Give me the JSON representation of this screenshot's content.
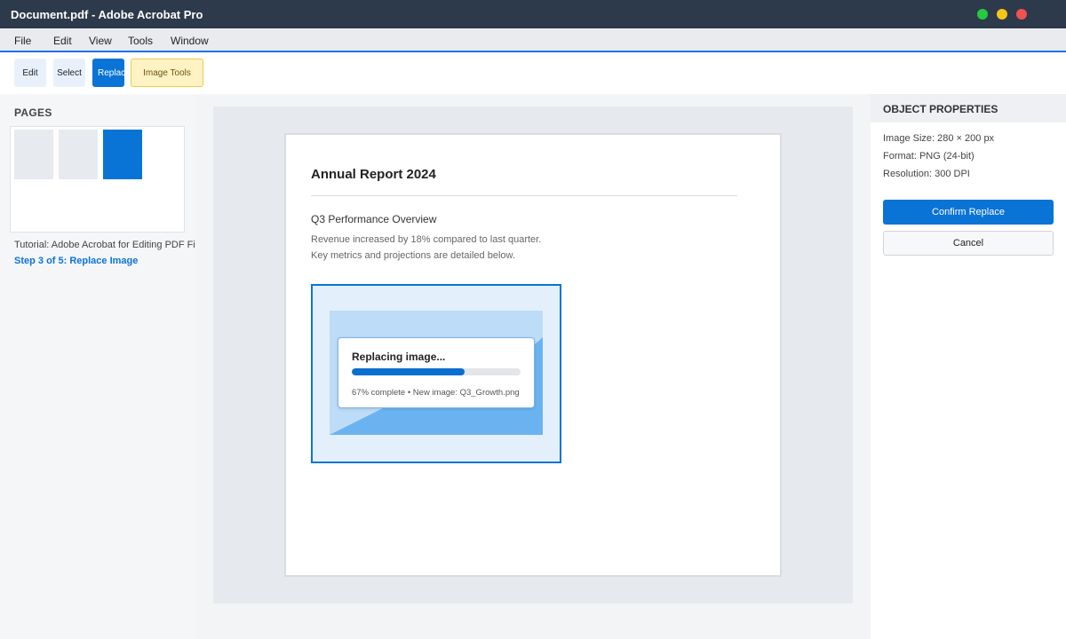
{
  "window": {
    "title": "Document.pdf - Adobe Acrobat Pro"
  },
  "menu": [
    "File",
    "Edit",
    "View",
    "Tools",
    "Window"
  ],
  "toolbar": {
    "edit": "Edit",
    "select": "Select",
    "replace": "Replace",
    "image_tools": "Image Tools"
  },
  "sidebar": {
    "heading": "PAGES",
    "tutorial_label": "Tutorial: Adobe Acrobat for Editing PDF Files",
    "tutorial_step": "Step 3 of 5: Replace Image"
  },
  "document": {
    "title": "Annual Report 2024",
    "subtitle": "Q3 Performance Overview",
    "lines": [
      "Revenue increased by 18% compared to last quarter.",
      "Key metrics and projections are detailed below."
    ]
  },
  "replace_dialog": {
    "title": "Replacing image...",
    "progress_fraction": 0.67,
    "status": "67% complete • New image: Q3_Growth.png"
  },
  "properties": {
    "heading": "OBJECT PROPERTIES",
    "image_size": "Image Size: 280 × 200 px",
    "format": "Format: PNG (24-bit)",
    "resolution": "Resolution: 300 DPI",
    "confirm_label": "Confirm Replace",
    "cancel_label": "Cancel"
  },
  "colors": {
    "accent": "#0a73d6",
    "titlebar": "#2d3a4b"
  }
}
